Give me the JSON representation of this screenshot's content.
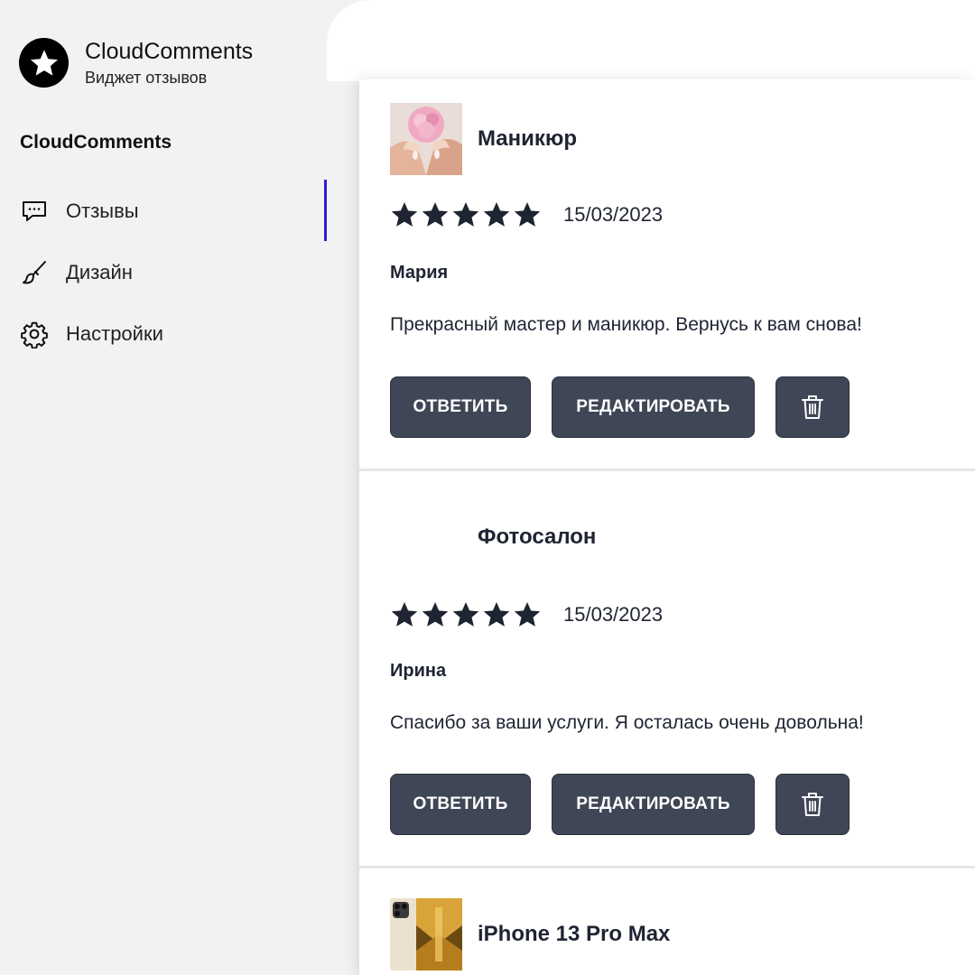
{
  "brand": {
    "title": "CloudComments",
    "subtitle": "Виджет отзывов",
    "logo_icon": "star-icon"
  },
  "sidebar": {
    "section_title": "CloudComments",
    "items": [
      {
        "label": "Отзывы",
        "icon": "chat-bubble-icon",
        "active": true
      },
      {
        "label": "Дизайн",
        "icon": "brush-icon",
        "active": false
      },
      {
        "label": "Настройки",
        "icon": "gear-icon",
        "active": false
      }
    ],
    "active_color": "#2f1fd1"
  },
  "reviews": [
    {
      "product": "Маникюр",
      "thumb": "manicure-thumbnail",
      "rating": 5,
      "date": "15/03/2023",
      "author": "Мария",
      "text": "Прекрасный мастер и маникюр. Вернусь к вам снова!"
    },
    {
      "product": "Фотосалон",
      "thumb": "",
      "rating": 5,
      "date": "15/03/2023",
      "author": "Ирина",
      "text": "Спасибо за ваши услуги. Я осталась очень довольна!"
    },
    {
      "product": "iPhone 13 Pro Max",
      "thumb": "iphone-thumbnail"
    }
  ],
  "actions": {
    "reply_label": "ОТВЕТИТЬ",
    "edit_label": "РЕДАКТИРОВАТЬ",
    "delete_icon": "trash-icon"
  },
  "colors": {
    "button_bg": "#3f4655",
    "text_dark": "#1f2433",
    "sidebar_bg": "#f2f2f2"
  }
}
